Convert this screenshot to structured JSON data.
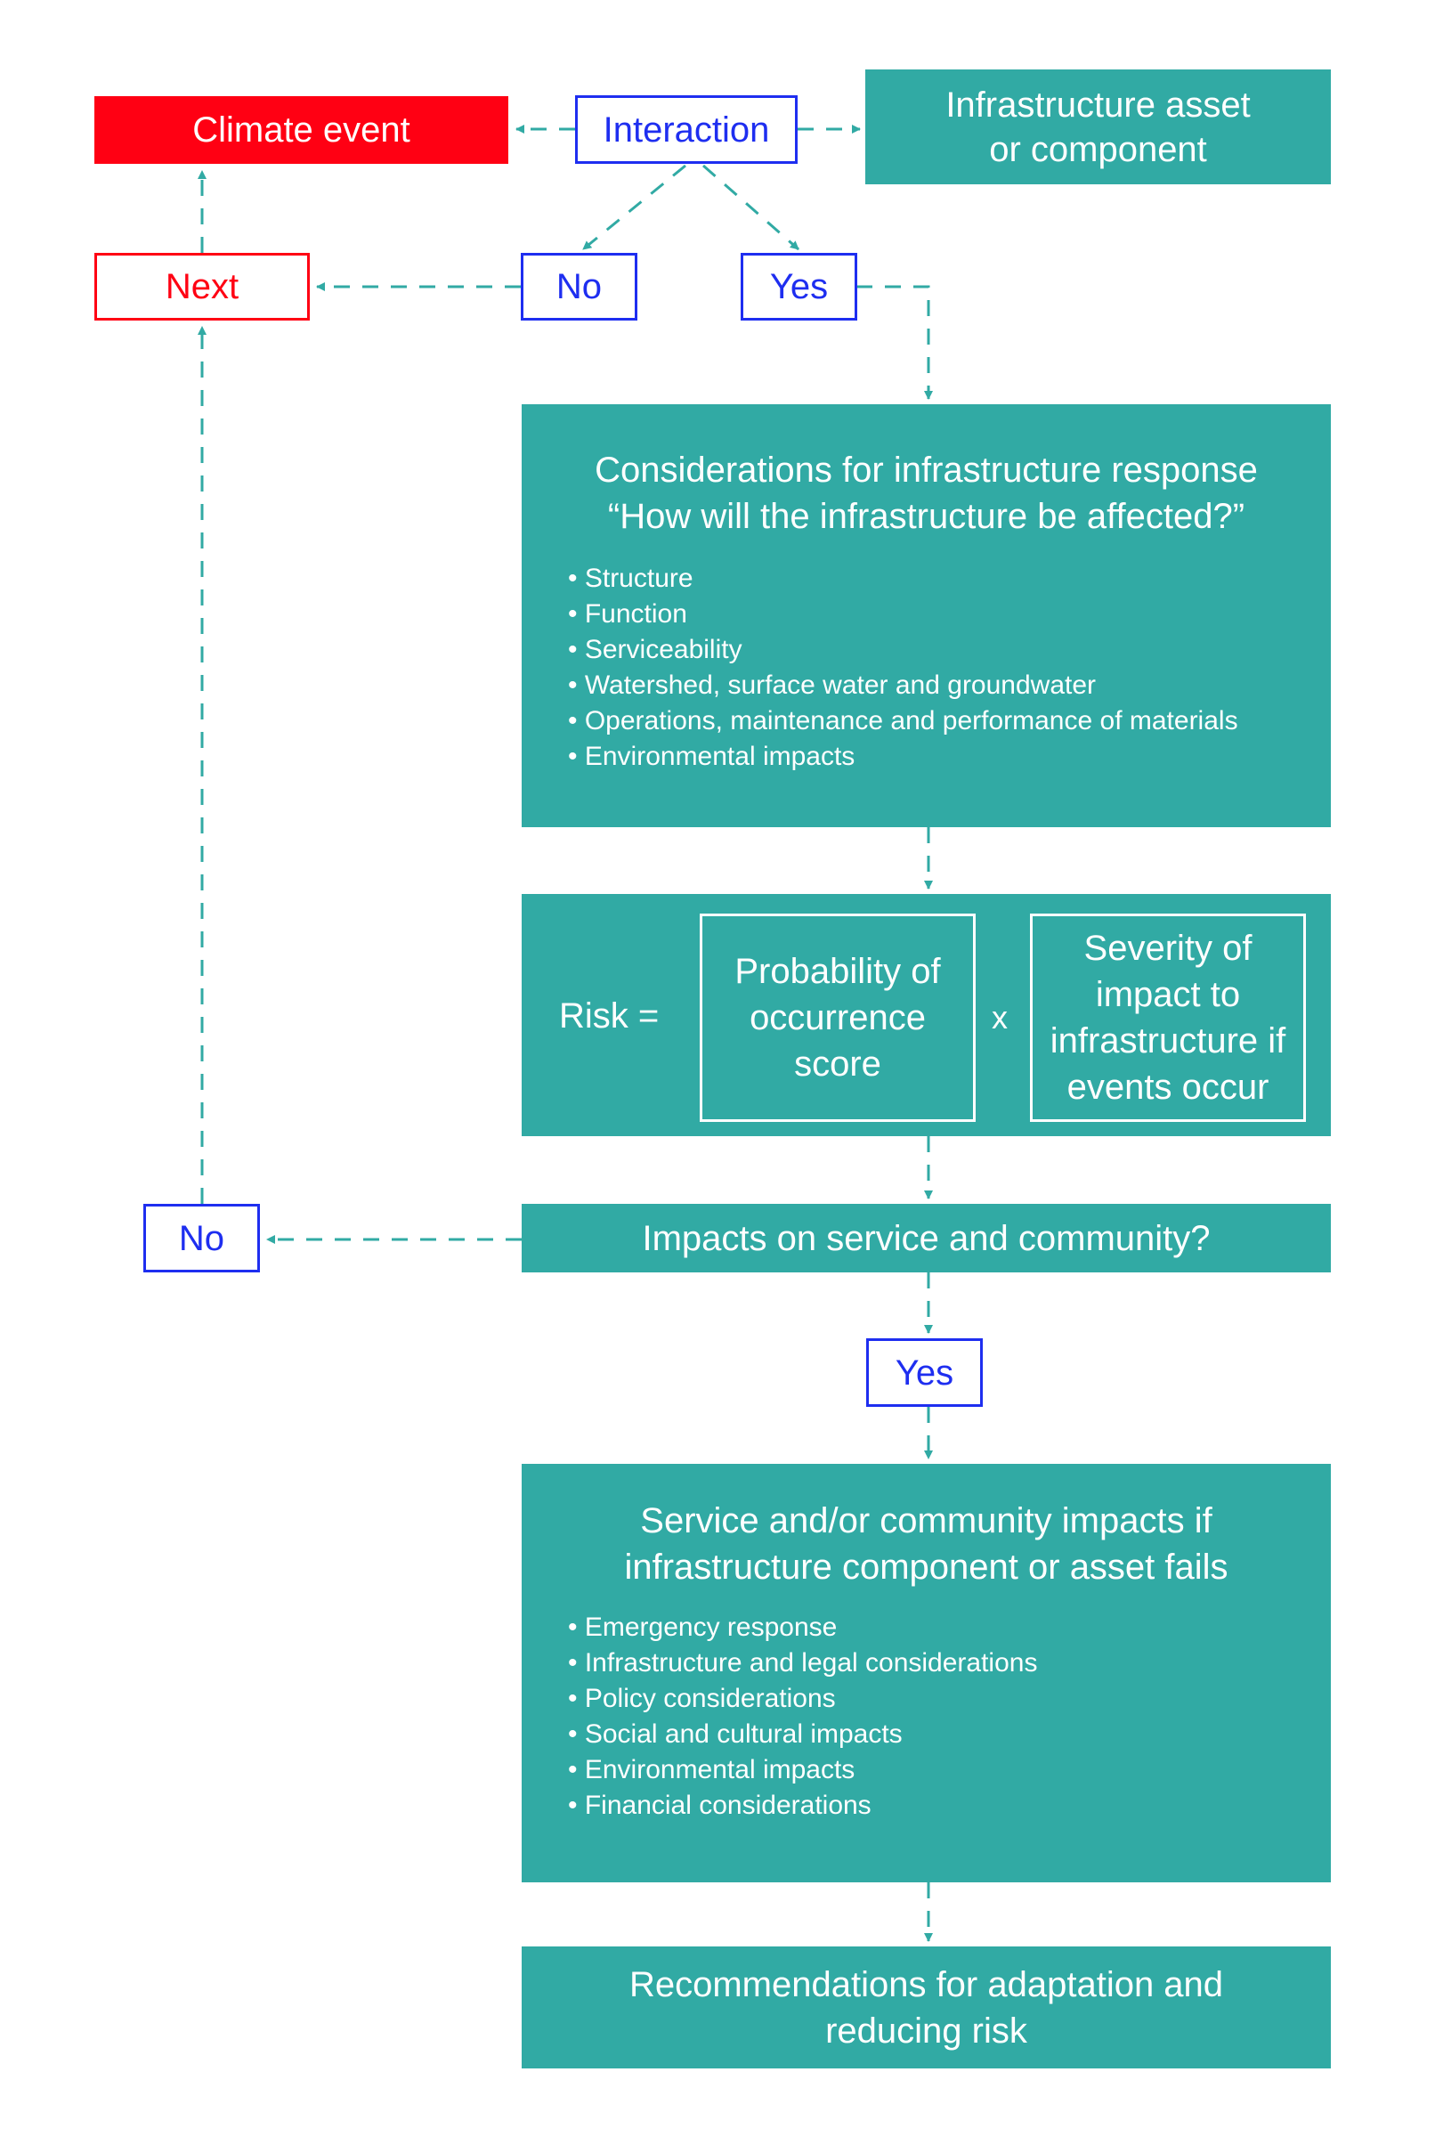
{
  "colors": {
    "climate_red": "#ff0013",
    "decision_blue": "#1e2ef0",
    "process_teal": "#31aaa4",
    "connector_teal": "#31aaa4"
  },
  "nodes": {
    "climate_event": "Climate event",
    "interaction": "Interaction",
    "infrastructure_asset": "Infrastructure asset or component",
    "next": "Next",
    "no_top": "No",
    "yes_top": "Yes",
    "considerations": {
      "title": "Considerations for infrastructure response",
      "subtitle": "“How will the infrastructure be affected?”",
      "items": [
        "Structure",
        "Function",
        "Serviceability",
        "Watershed, surface water and groundwater",
        "Operations, maintenance and performance of materials",
        "Environmental impacts"
      ]
    },
    "risk": {
      "label": "Risk =",
      "probability": "Probability of occurrence score",
      "operator": "x",
      "severity": "Severity of impact to infrastructure if events occur"
    },
    "impacts_question": "Impacts on service and community?",
    "no_bottom": "No",
    "yes_bottom": "Yes",
    "service_impacts": {
      "title": "Service and/or community impacts if infrastructure component or asset fails",
      "items": [
        "Emergency response",
        "Infrastructure and legal considerations",
        "Policy considerations",
        "Social and cultural impacts",
        "Environmental impacts",
        "Financial considerations"
      ]
    },
    "recommendations": "Recommendations for adaptation and reducing risk"
  },
  "edges": [
    {
      "from": "interaction",
      "to": "climate_event"
    },
    {
      "from": "interaction",
      "to": "infrastructure_asset"
    },
    {
      "from": "interaction",
      "to": "no_top"
    },
    {
      "from": "interaction",
      "to": "yes_top"
    },
    {
      "from": "no_top",
      "to": "next"
    },
    {
      "from": "next",
      "to": "climate_event"
    },
    {
      "from": "yes_top",
      "to": "considerations"
    },
    {
      "from": "considerations",
      "to": "risk"
    },
    {
      "from": "risk",
      "to": "impacts_question"
    },
    {
      "from": "impacts_question",
      "to": "no_bottom"
    },
    {
      "from": "no_bottom",
      "to": "next"
    },
    {
      "from": "impacts_question",
      "to": "yes_bottom"
    },
    {
      "from": "yes_bottom",
      "to": "service_impacts"
    },
    {
      "from": "service_impacts",
      "to": "recommendations"
    }
  ]
}
